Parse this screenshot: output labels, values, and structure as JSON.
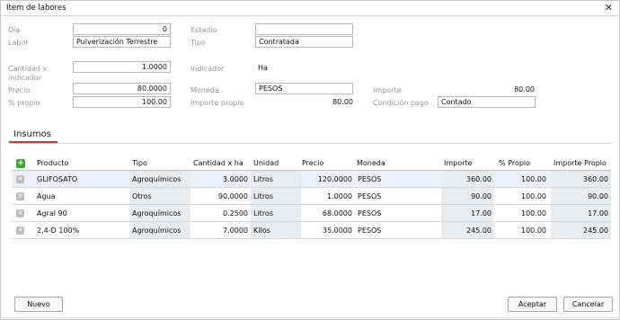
{
  "dialog": {
    "title": "Item de labores",
    "close_glyph": "✕"
  },
  "form": {
    "dia": {
      "label": "Día",
      "value": "0"
    },
    "labor": {
      "label": "Labor",
      "value": "Pulverización Terrestre"
    },
    "estadio": {
      "label": "Estadio",
      "value": ""
    },
    "tipo": {
      "label": "Tipo",
      "value": "Contratada"
    },
    "cantidad": {
      "label_line1": "Cantidad x",
      "label_line2": "indicador",
      "value": "1.0000"
    },
    "indicador": {
      "label": "Indicador",
      "value": "Ha"
    },
    "precio": {
      "label": "Precio",
      "value": "80.0000"
    },
    "moneda": {
      "label": "Moneda",
      "value": "PESOS"
    },
    "importe": {
      "label": "Importe",
      "value": "80.00"
    },
    "propio": {
      "label": "% propio",
      "value": "100.00"
    },
    "importe_propio": {
      "label": "Importe propio",
      "value": "80.00"
    },
    "condicion_pago": {
      "label": "Condición pago",
      "value": "Contado"
    }
  },
  "tabs": {
    "insumos": "Insumos"
  },
  "grid": {
    "add_icon": "plus-icon",
    "columns": [
      "Producto",
      "Tipo",
      "Cantidad x ha",
      "Unidad",
      "Precio",
      "Moneda",
      "Importe",
      "% Propio",
      "Importe Propio"
    ],
    "rows": [
      {
        "producto": "GLIFOSATO",
        "tipo": "Agroquímicos",
        "cantidad": "3.0000",
        "unidad": "Litros",
        "precio": "120.0000",
        "moneda": "PESOS",
        "importe": "360.00",
        "propio": "100.00",
        "importe_propio": "360.00"
      },
      {
        "producto": "Agua",
        "tipo": "Otros",
        "cantidad": "90.0000",
        "unidad": "Litros",
        "precio": "1.0000",
        "moneda": "PESOS",
        "importe": "90.00",
        "propio": "100.00",
        "importe_propio": "90.00"
      },
      {
        "producto": "Agral 90",
        "tipo": "Agroquímicos",
        "cantidad": "0.2500",
        "unidad": "Litros",
        "precio": "68.0000",
        "moneda": "PESOS",
        "importe": "17.00",
        "propio": "100.00",
        "importe_propio": "17.00"
      },
      {
        "producto": "2,4-D 100%",
        "tipo": "Agroquímicos",
        "cantidad": "7.0000",
        "unidad": "Kilos",
        "precio": "35.0000",
        "moneda": "PESOS",
        "importe": "245.00",
        "propio": "100.00",
        "importe_propio": "245.00"
      }
    ]
  },
  "buttons": {
    "nuevo": "Nuevo",
    "aceptar": "Aceptar",
    "cancelar": "Cancelar"
  },
  "colors": {
    "tab_accent": "#d9342b",
    "add_green": "#3fa535",
    "selected_row": "#eaf1fa",
    "shaded_cell": "#e9ecef"
  }
}
